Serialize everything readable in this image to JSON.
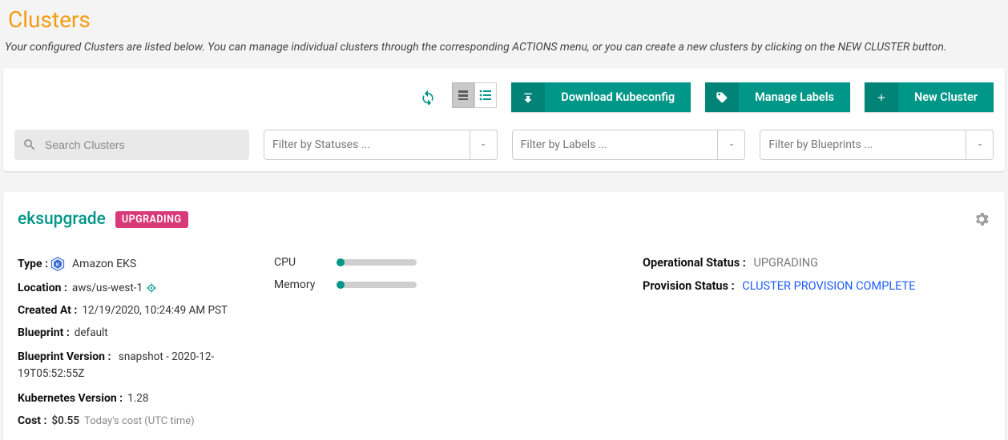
{
  "header": {
    "title": "Clusters",
    "subtitle": "Your configured Clusters are listed below. You can manage individual clusters through the corresponding ACTIONS menu, or you can create a new clusters by clicking on the NEW CLUSTER button."
  },
  "toolbar": {
    "download_kubeconfig": "Download Kubeconfig",
    "manage_labels": "Manage Labels",
    "new_cluster": "New Cluster"
  },
  "filters": {
    "search_placeholder": "Search Clusters",
    "status_placeholder": "Filter by Statuses ...",
    "labels_placeholder": "Filter by Labels ...",
    "blueprints_placeholder": "Filter by Blueprints ..."
  },
  "cluster": {
    "name": "eksupgrade",
    "badge": "UPGRADING",
    "labels": {
      "type": "Type :",
      "location": "Location :",
      "created_at": "Created At :",
      "blueprint": "Blueprint :",
      "blueprint_version": "Blueprint Version :",
      "k8s_version": "Kubernetes Version :",
      "cost": "Cost :",
      "cpu": "CPU",
      "memory": "Memory",
      "op_status": "Operational Status :",
      "prov_status": "Provision Status :"
    },
    "values": {
      "type": "Amazon EKS",
      "location": "aws/us-west-1",
      "created_at": "12/19/2020, 10:24:49 AM PST",
      "blueprint": "default",
      "blueprint_version": "snapshot - 2020-12-19T05:52:55Z",
      "k8s_version": "1.28",
      "cost": "$0.55",
      "cost_note": "Today's cost (UTC time)",
      "op_status": "UPGRADING",
      "prov_status": "CLUSTER PROVISION COMPLETE"
    },
    "meters": {
      "cpu_pct": 0,
      "memory_pct": 0
    }
  }
}
